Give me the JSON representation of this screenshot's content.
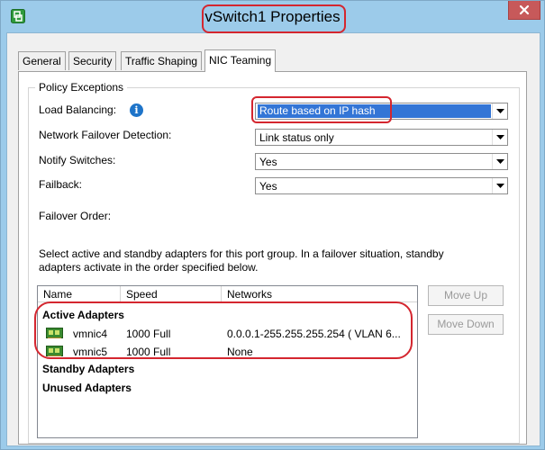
{
  "window": {
    "title": "vSwitch1 Properties"
  },
  "tabs": [
    {
      "label": "General"
    },
    {
      "label": "Security"
    },
    {
      "label": "Traffic Shaping"
    },
    {
      "label": "NIC Teaming"
    }
  ],
  "policy": {
    "legend": "Policy Exceptions",
    "load_balancing_label": "Load Balancing:",
    "load_balancing_value": "Route based on IP hash",
    "failover_detection_label": "Network Failover Detection:",
    "failover_detection_value": "Link status only",
    "notify_switches_label": "Notify Switches:",
    "notify_switches_value": "Yes",
    "failback_label": "Failback:",
    "failback_value": "Yes"
  },
  "failover": {
    "label": "Failover Order:",
    "description": "Select active and standby adapters for this port group.  In a failover situation, standby adapters activate  in the order specified below."
  },
  "adapters": {
    "columns": [
      "Name",
      "Speed",
      "Networks"
    ],
    "active_group": "Active Adapters",
    "standby_group": "Standby Adapters",
    "unused_group": "Unused Adapters",
    "rows": [
      {
        "name": "vmnic4",
        "speed": "1000 Full",
        "networks": "0.0.0.1-255.255.255.254 ( VLAN 6..."
      },
      {
        "name": "vmnic5",
        "speed": "1000 Full",
        "networks": "None"
      }
    ]
  },
  "buttons": {
    "move_up": "Move Up",
    "move_down": "Move Down"
  },
  "colors": {
    "annotation": "#d4262f",
    "selection": "#3375d6",
    "window_frame": "#9ccbea",
    "close_button": "#c7595a"
  },
  "icons": {
    "app": "vsphere-client-icon",
    "close": "close-icon",
    "info": "info-icon",
    "dropdown": "chevron-down-icon",
    "adapter": "network-adapter-icon"
  }
}
